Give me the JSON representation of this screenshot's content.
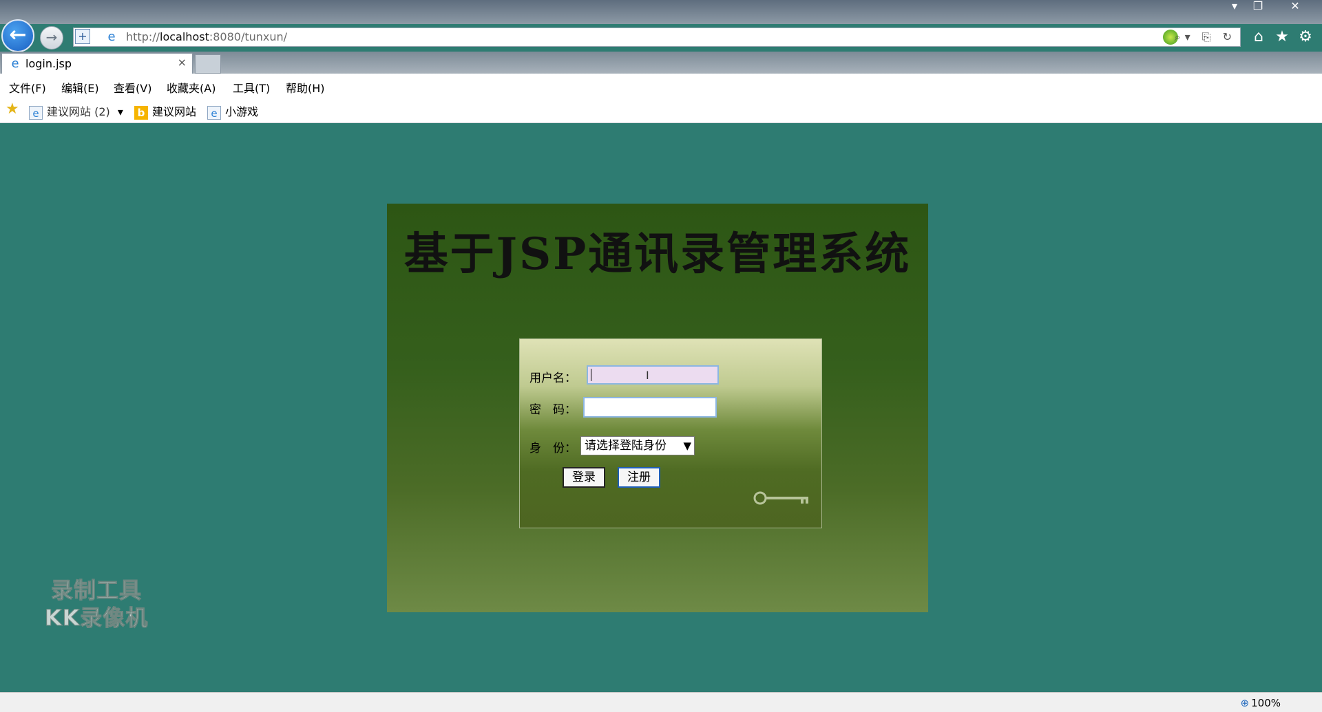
{
  "browser": {
    "url_prefix": "http://",
    "url_host": "localhost",
    "url_rest": ":8080/tunxun/",
    "tab_title": "login.jsp",
    "tab_close": "×",
    "window_controls": [
      "▾",
      "❐",
      "✕"
    ],
    "address_tools": "⌕▾ ⎘ ↻"
  },
  "menu": [
    "文件(F)",
    "编辑(E)",
    "查看(V)",
    "收藏夹(A)",
    "工具(T)",
    "帮助(H)"
  ],
  "favorites": {
    "items": [
      {
        "label": "建议网站 (2)",
        "icon": "ie-icon",
        "dropdown": "▾"
      },
      {
        "label": "建议网站",
        "icon": "bing-icon"
      },
      {
        "label": "小游戏",
        "icon": "ie-icon"
      }
    ]
  },
  "page": {
    "title": "基于JSP通讯录管理系统",
    "form": {
      "username_label": "用户名：",
      "username_value": "",
      "password_label": "密　码：",
      "password_value": "",
      "role_label": "身　份：",
      "role_selected": "请选择登陆身份",
      "login_button": "登录",
      "register_button": "注册"
    },
    "watermark": [
      "录制工具",
      "KK录像机"
    ]
  },
  "status": {
    "zoom": "100%"
  },
  "colors": {
    "page_bg": "#2e7c72",
    "panel_top": "#2d5614",
    "panel_bottom": "#6e8a46",
    "focus_border": "#8cb6e2"
  }
}
